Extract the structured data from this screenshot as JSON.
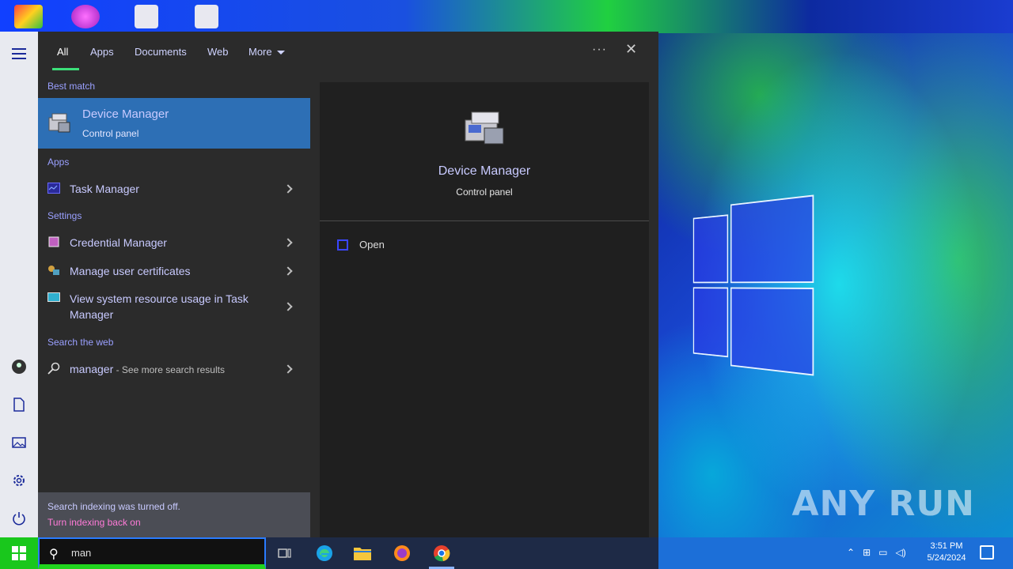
{
  "desktop": {
    "watermark": "ANY RUN",
    "icons": [
      "app-icon-1",
      "app-icon-2",
      "file-icon-1",
      "file-icon-2"
    ]
  },
  "search_panel": {
    "tabs": [
      {
        "label": "All",
        "active": true
      },
      {
        "label": "Apps"
      },
      {
        "label": "Documents"
      },
      {
        "label": "Web"
      },
      {
        "label": "More"
      }
    ],
    "ellipsis": "···",
    "close": "✕",
    "sections": {
      "best_match": "Best match",
      "apps": "Apps",
      "settings": "Settings",
      "search_web": "Search the web"
    },
    "best_match": {
      "title": "Device Manager",
      "subtitle": "Control panel"
    },
    "apps": [
      {
        "label": "Task Manager"
      }
    ],
    "settings": [
      {
        "label": "Credential Manager"
      },
      {
        "label": "Manage user certificates"
      },
      {
        "label": "View system resource usage in Task Manager"
      }
    ],
    "web": {
      "query": "manager",
      "suffix": " - See more search results"
    },
    "indexing": {
      "line1": "Search indexing was turned off.",
      "line2": "Turn indexing back on"
    },
    "preview": {
      "title": "Device Manager",
      "subtitle": "Control panel",
      "action": "Open"
    }
  },
  "taskbar": {
    "search_value": "man",
    "clock_time": "3:51 PM",
    "clock_date": "5/24/2024"
  }
}
